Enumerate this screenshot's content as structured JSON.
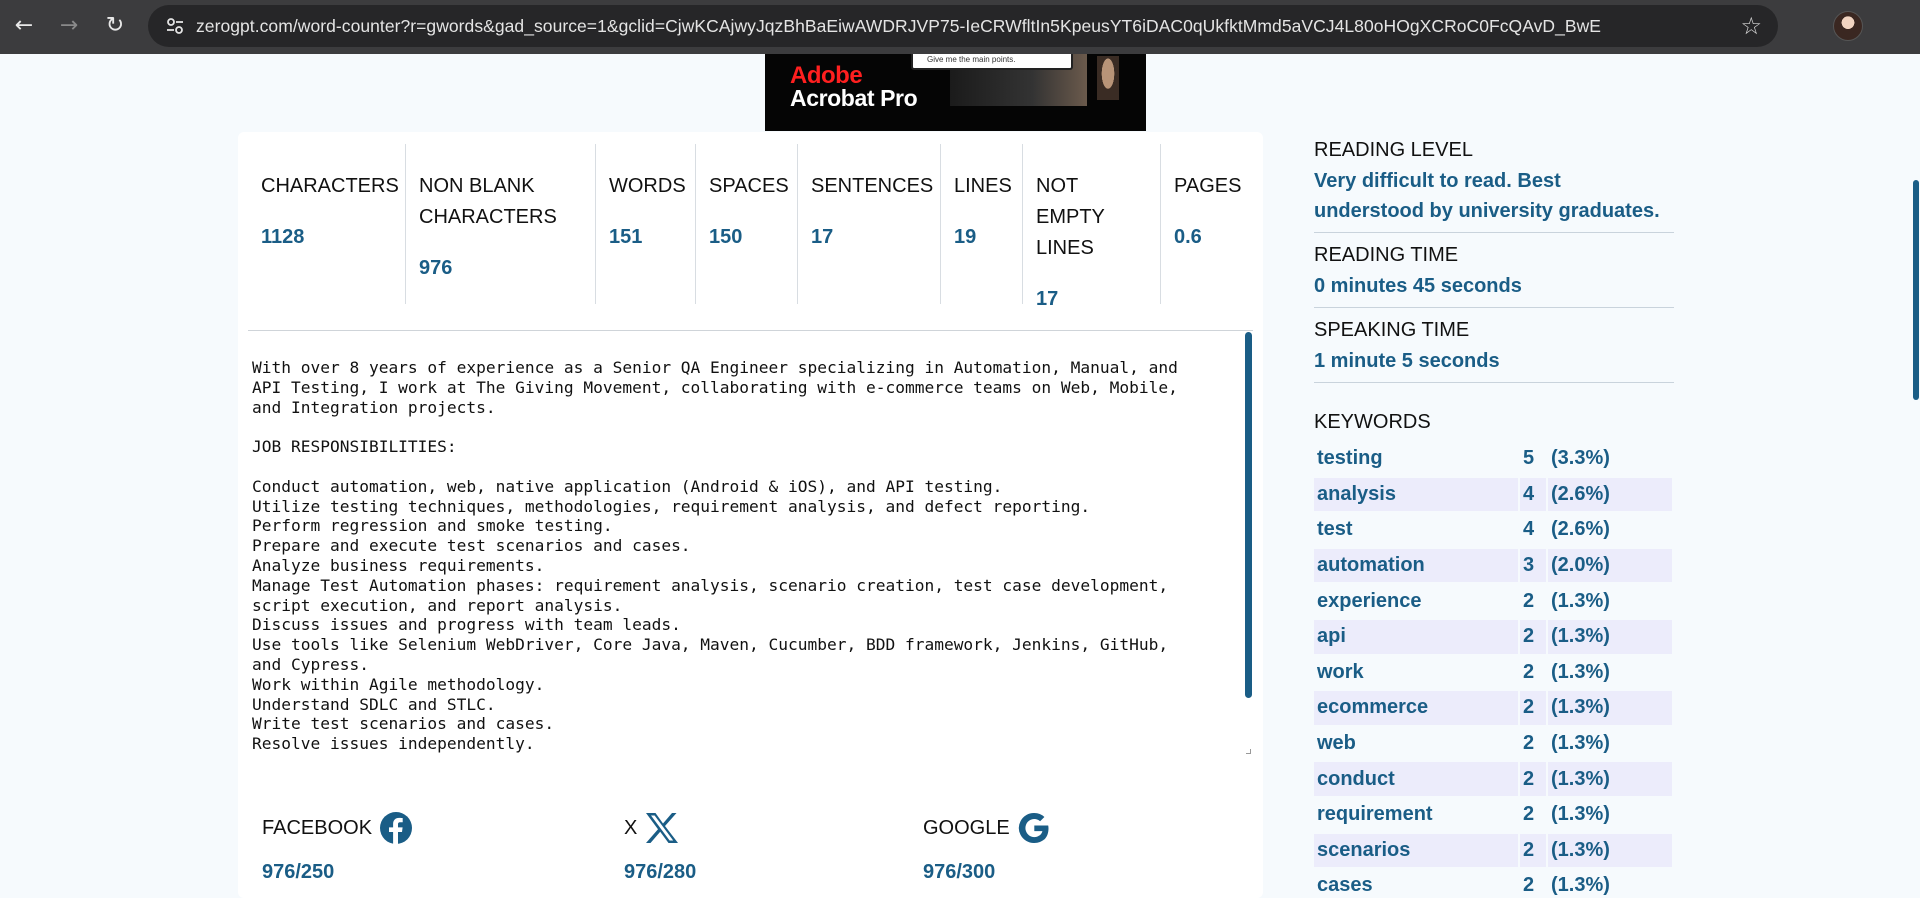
{
  "browser": {
    "url": "zerogpt.com/word-counter?r=gwords&gad_source=1&gclid=CjwKCAjwyJqzBhBaEiwAWDRJVP75-IeCRWfltIn5KpeusYT6iDAC0qUkfktMmd5aVCJ4L80oHOgXCRoC0FcQAvD_BwE"
  },
  "ad": {
    "brand": "Adobe",
    "product": "Acrobat Pro",
    "card_text": "Give me the main points."
  },
  "stats": [
    {
      "label": "CHARACTERS",
      "value": "1128"
    },
    {
      "label": "NON BLANK CHARACTERS",
      "value": "976"
    },
    {
      "label": "WORDS",
      "value": "151"
    },
    {
      "label": "SPACES",
      "value": "150"
    },
    {
      "label": "SENTENCES",
      "value": "17"
    },
    {
      "label": "LINES",
      "value": "19"
    },
    {
      "label": "NOT EMPTY LINES",
      "value": "17"
    },
    {
      "label": "PAGES",
      "value": "0.6"
    }
  ],
  "editor": {
    "text": "With over 8 years of experience as a Senior QA Engineer specializing in Automation, Manual, and\nAPI Testing, I work at The Giving Movement, collaborating with e-commerce teams on Web, Mobile,\nand Integration projects.\n\nJOB RESPONSIBILITIES:\n\nConduct automation, web, native application (Android & iOS), and API testing.\nUtilize testing techniques, methodologies, requirement analysis, and defect reporting.\nPerform regression and smoke testing.\nPrepare and execute test scenarios and cases.\nAnalyze business requirements.\nManage Test Automation phases: requirement analysis, scenario creation, test case development,\nscript execution, and report analysis.\nDiscuss issues and progress with team leads.\nUse tools like Selenium WebDriver, Core Java, Maven, Cucumber, BDD framework, Jenkins, GitHub,\nand Cypress.\nWork within Agile methodology.\nUnderstand SDLC and STLC.\nWrite test scenarios and cases.\nResolve issues independently."
  },
  "social": [
    {
      "label": "FACEBOOK",
      "icon": "facebook-icon",
      "value": "976/250"
    },
    {
      "label": "X",
      "icon": "x-icon",
      "value": "976/280"
    },
    {
      "label": "GOOGLE",
      "icon": "google-icon",
      "value": "976/300"
    }
  ],
  "reading_level": {
    "label": "READING LEVEL",
    "value": "Very difficult to read. Best understood by university graduates."
  },
  "reading_time": {
    "label": "READING TIME",
    "value": "0 minutes 45 seconds"
  },
  "speaking_time": {
    "label": "SPEAKING TIME",
    "value": "1 minute 5 seconds"
  },
  "keywords": {
    "title": "KEYWORDS",
    "rows": [
      {
        "word": "testing",
        "count": "5",
        "pct": "(3.3%)"
      },
      {
        "word": "analysis",
        "count": "4",
        "pct": "(2.6%)"
      },
      {
        "word": "test",
        "count": "4",
        "pct": "(2.6%)"
      },
      {
        "word": "automation",
        "count": "3",
        "pct": "(2.0%)"
      },
      {
        "word": "experience",
        "count": "2",
        "pct": "(1.3%)"
      },
      {
        "word": "api",
        "count": "2",
        "pct": "(1.3%)"
      },
      {
        "word": "work",
        "count": "2",
        "pct": "(1.3%)"
      },
      {
        "word": "ecommerce",
        "count": "2",
        "pct": "(1.3%)"
      },
      {
        "word": "web",
        "count": "2",
        "pct": "(1.3%)"
      },
      {
        "word": "conduct",
        "count": "2",
        "pct": "(1.3%)"
      },
      {
        "word": "requirement",
        "count": "2",
        "pct": "(1.3%)"
      },
      {
        "word": "scenarios",
        "count": "2",
        "pct": "(1.3%)"
      },
      {
        "word": "cases",
        "count": "2",
        "pct": "(1.3%)"
      }
    ]
  },
  "colors": {
    "accent": "#1a5d86",
    "chrome": "#3c3c3e",
    "row_alt": "#ececfb"
  }
}
